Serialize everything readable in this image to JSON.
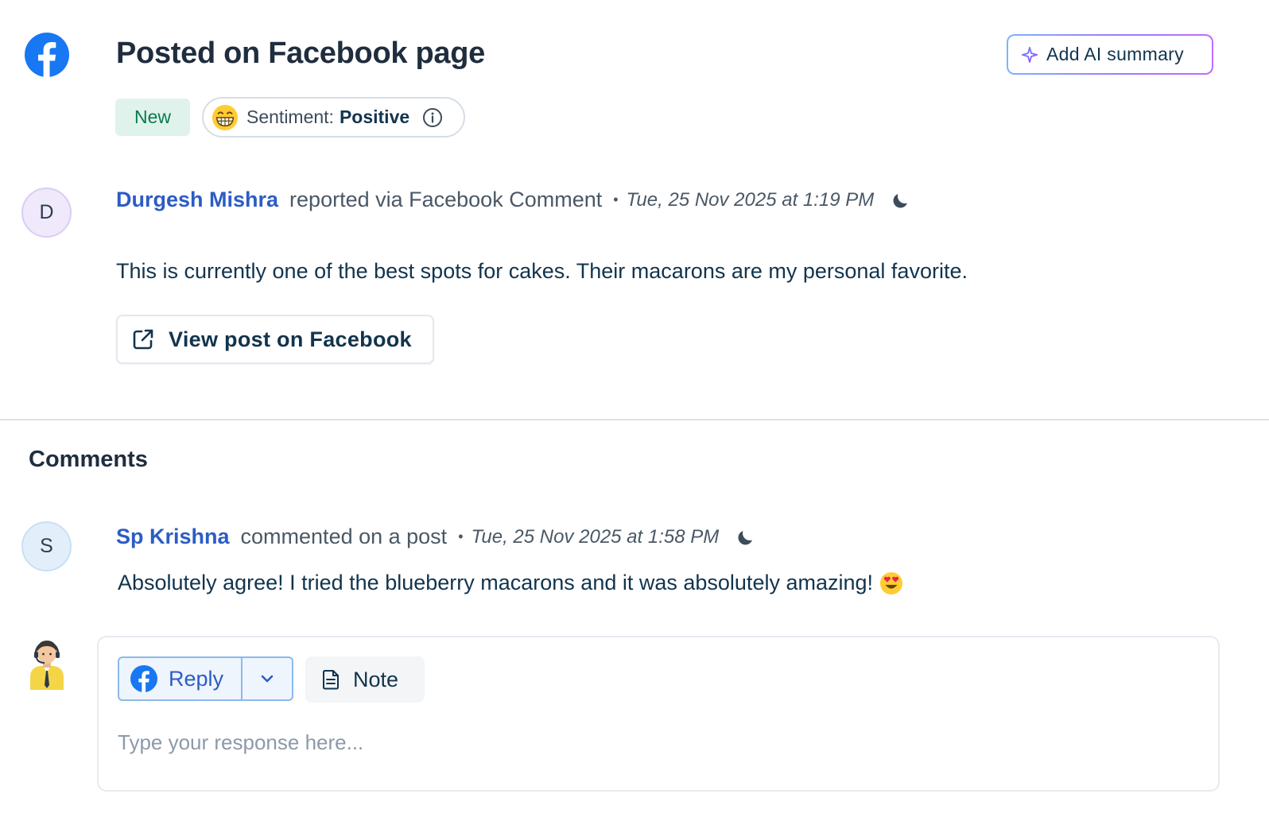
{
  "header": {
    "title": "Posted on Facebook page",
    "ai_summary_label": "Add AI summary",
    "status_badge": "New",
    "sentiment_label": "Sentiment:",
    "sentiment_value": "Positive"
  },
  "post": {
    "author_initial": "D",
    "author": "Durgesh Mishra",
    "action": "reported via Facebook Comment",
    "separator": "•",
    "timestamp": "Tue, 25 Nov 2025 at 1:19 PM",
    "body": "This is currently one of the best spots for cakes. Their macarons are my personal favorite.",
    "view_button_label": "View post on Facebook"
  },
  "comments": {
    "heading": "Comments",
    "items": [
      {
        "author_initial": "S",
        "author": "Sp Krishna",
        "action": "commented on a post",
        "separator": "•",
        "timestamp": "Tue, 25 Nov 2025 at 1:58 PM",
        "body": "Absolutely agree! I tried the blueberry macarons and it was absolutely amazing!"
      }
    ]
  },
  "composer": {
    "reply_label": "Reply",
    "note_label": "Note",
    "placeholder": "Type your response here..."
  },
  "icons": {
    "facebook": "facebook-icon",
    "sparkle": "sparkle-icon",
    "info": "info-icon",
    "moon": "moon-icon",
    "external_link": "external-link-icon",
    "chevron_down": "chevron-down-icon",
    "note": "note-icon",
    "emoji_grin": "grinning-face-icon",
    "emoji_heart_eyes": "heart-eyes-icon",
    "agent": "agent-avatar-icon"
  },
  "colors": {
    "facebook_blue": "#1877f2",
    "link_blue": "#2c5cc5",
    "new_badge_bg": "#dff3ec",
    "new_badge_text": "#0b7a4b",
    "text_primary": "#12344d",
    "ai_gradient_start": "#7fb2ff",
    "ai_gradient_end": "#c06bff"
  }
}
